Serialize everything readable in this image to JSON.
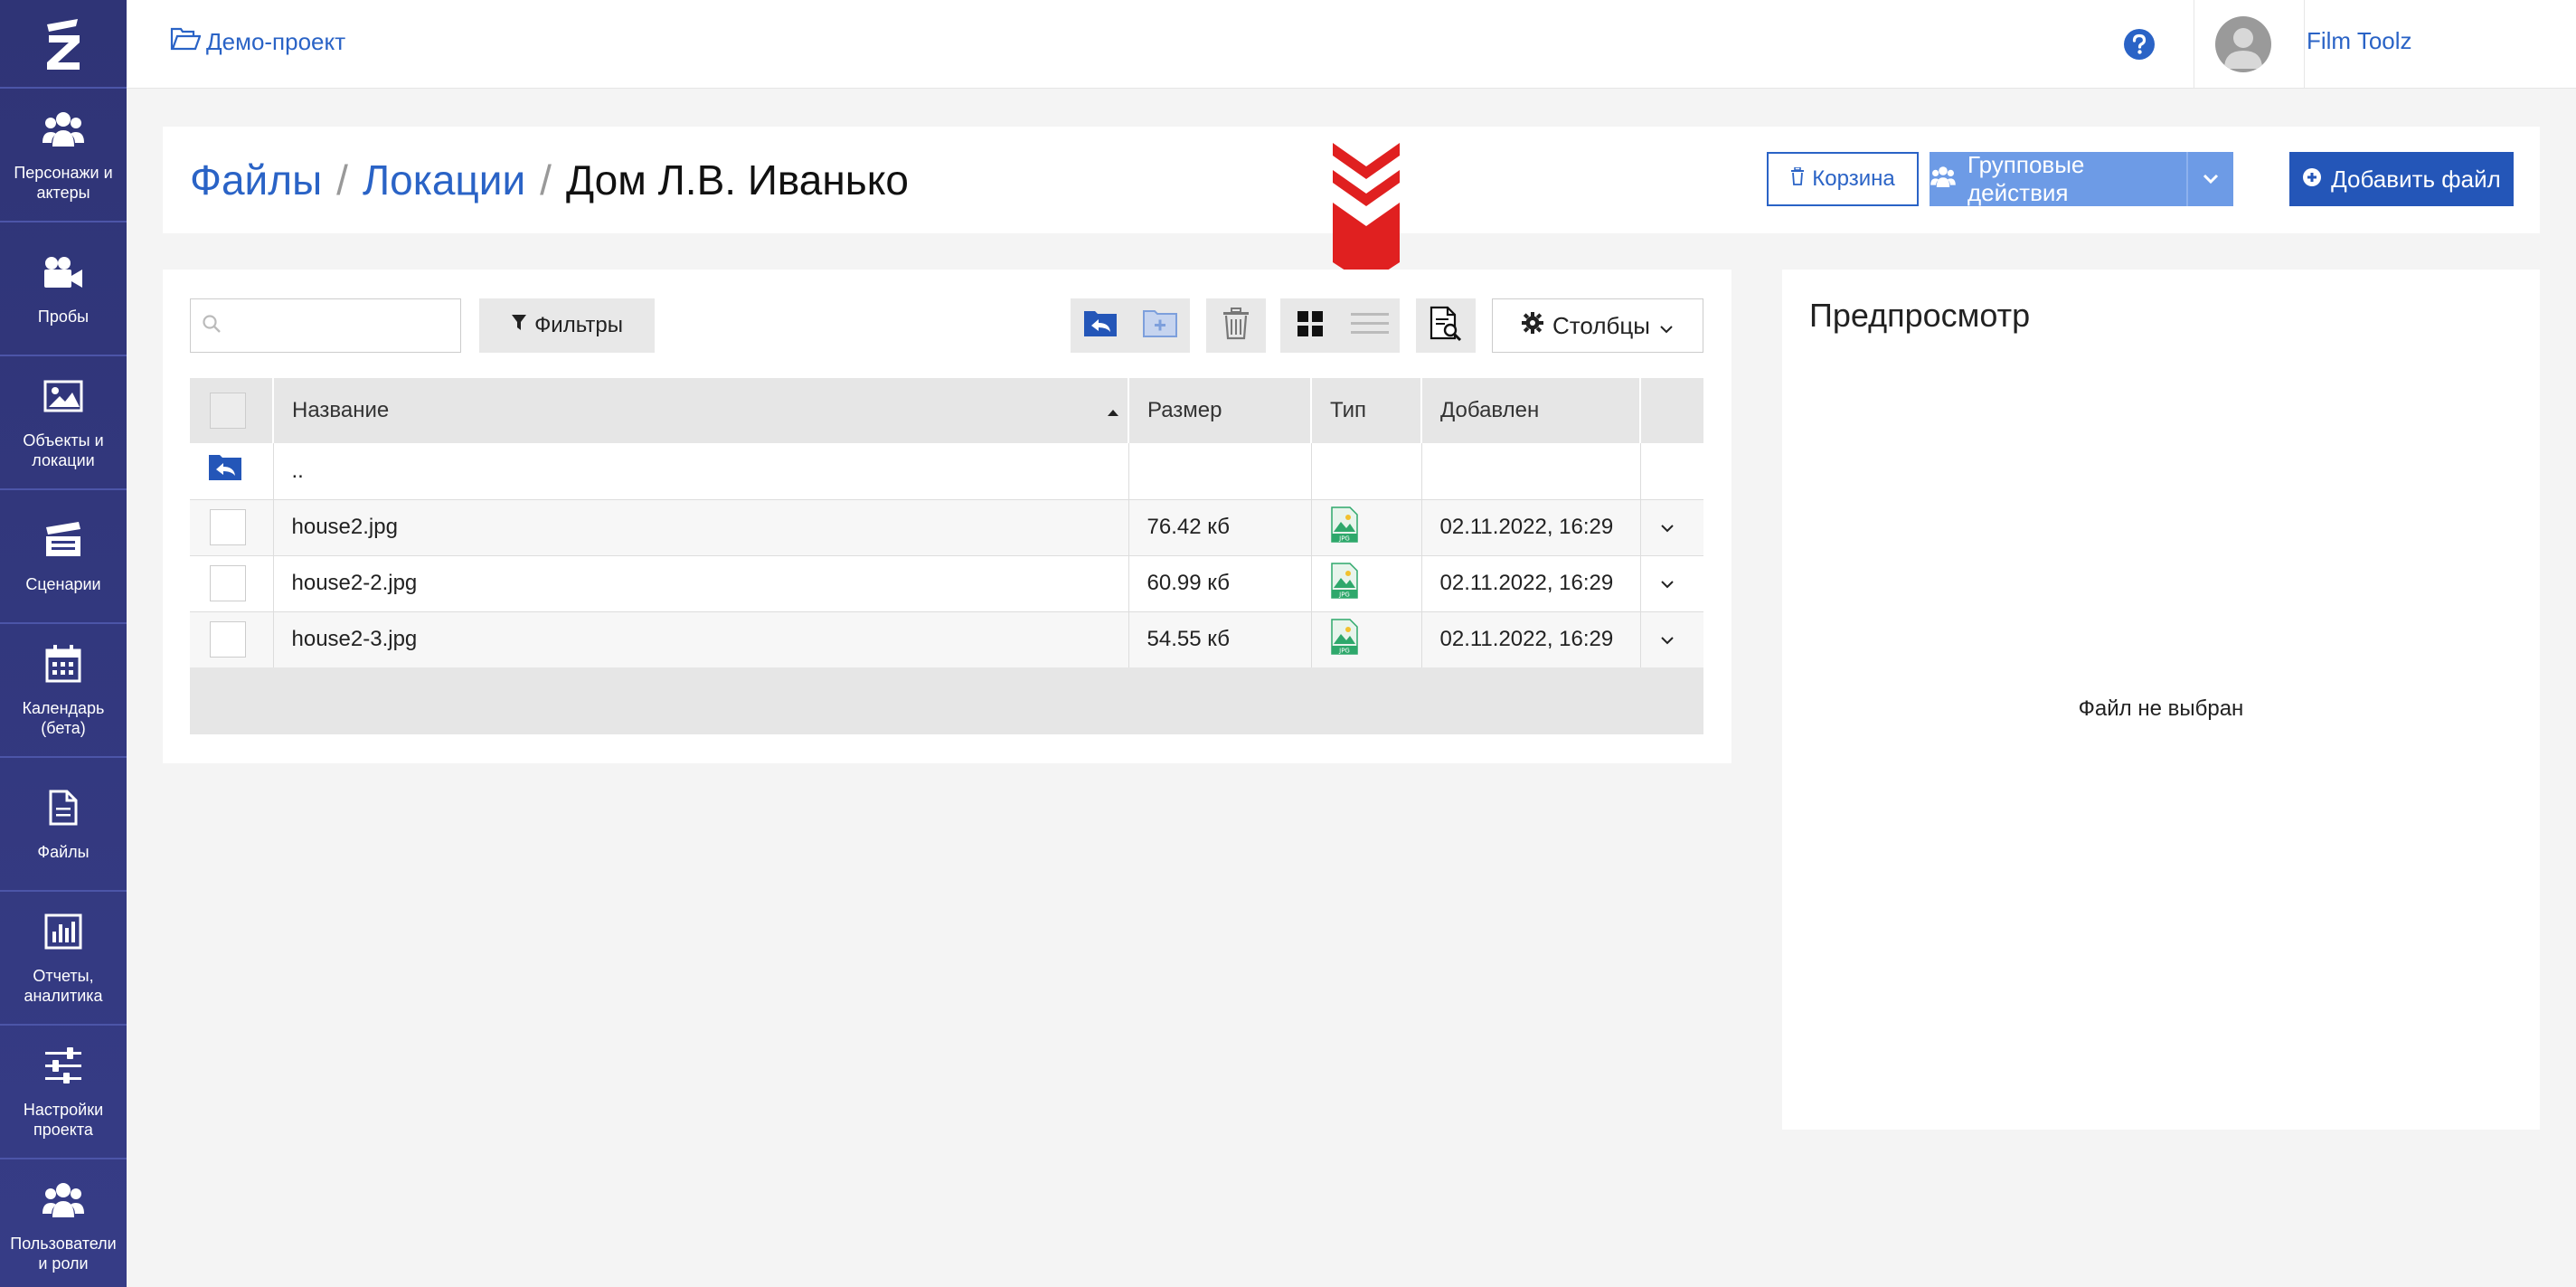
{
  "brand": {
    "accent": "#2a63c6",
    "sidebar_bg": "#2f3476",
    "arrow_color": "#e02020"
  },
  "sidebar": {
    "logo_icon": "z-logo-icon",
    "items": [
      {
        "label": "Персонажи и актеры",
        "icon": "people-icon"
      },
      {
        "label": "Пробы",
        "icon": "video-camera-icon"
      },
      {
        "label": "Объекты и локации",
        "icon": "image-icon"
      },
      {
        "label": "Сценарии",
        "icon": "clapperboard-icon"
      },
      {
        "label": "Календарь (бета)",
        "icon": "calendar-icon"
      },
      {
        "label": "Файлы",
        "icon": "file-icon"
      },
      {
        "label": "Отчеты, аналитика",
        "icon": "bar-chart-icon"
      },
      {
        "label": "Настройки проекта",
        "icon": "sliders-icon"
      },
      {
        "label": "Пользователи и роли",
        "icon": "users-icon"
      }
    ]
  },
  "topbar": {
    "project_label": "Демо-проект",
    "user_name": "Film Toolz"
  },
  "header": {
    "breadcrumb": [
      "Файлы",
      "Локации",
      "Дом Л.В. Иванько"
    ],
    "separator": "/",
    "trash_label": "Корзина",
    "group_actions_label": "Групповые действия",
    "add_file_label": "Добавить файл"
  },
  "toolbar": {
    "search_placeholder": "",
    "filter_label": "Фильтры",
    "columns_label": "Столбцы"
  },
  "table": {
    "columns": [
      "Название",
      "Размер",
      "Тип",
      "Добавлен"
    ],
    "sort_column": "Название",
    "parent_row": "..",
    "rows": [
      {
        "name": "house2.jpg",
        "size": "76.42 кб",
        "type": "JPG",
        "added": "02.11.2022, 16:29"
      },
      {
        "name": "house2-2.jpg",
        "size": "60.99 кб",
        "type": "JPG",
        "added": "02.11.2022, 16:29"
      },
      {
        "name": "house2-3.jpg",
        "size": "54.55 кб",
        "type": "JPG",
        "added": "02.11.2022, 16:29"
      }
    ]
  },
  "preview": {
    "title": "Предпросмотр",
    "empty_text": "Файл не выбран"
  }
}
